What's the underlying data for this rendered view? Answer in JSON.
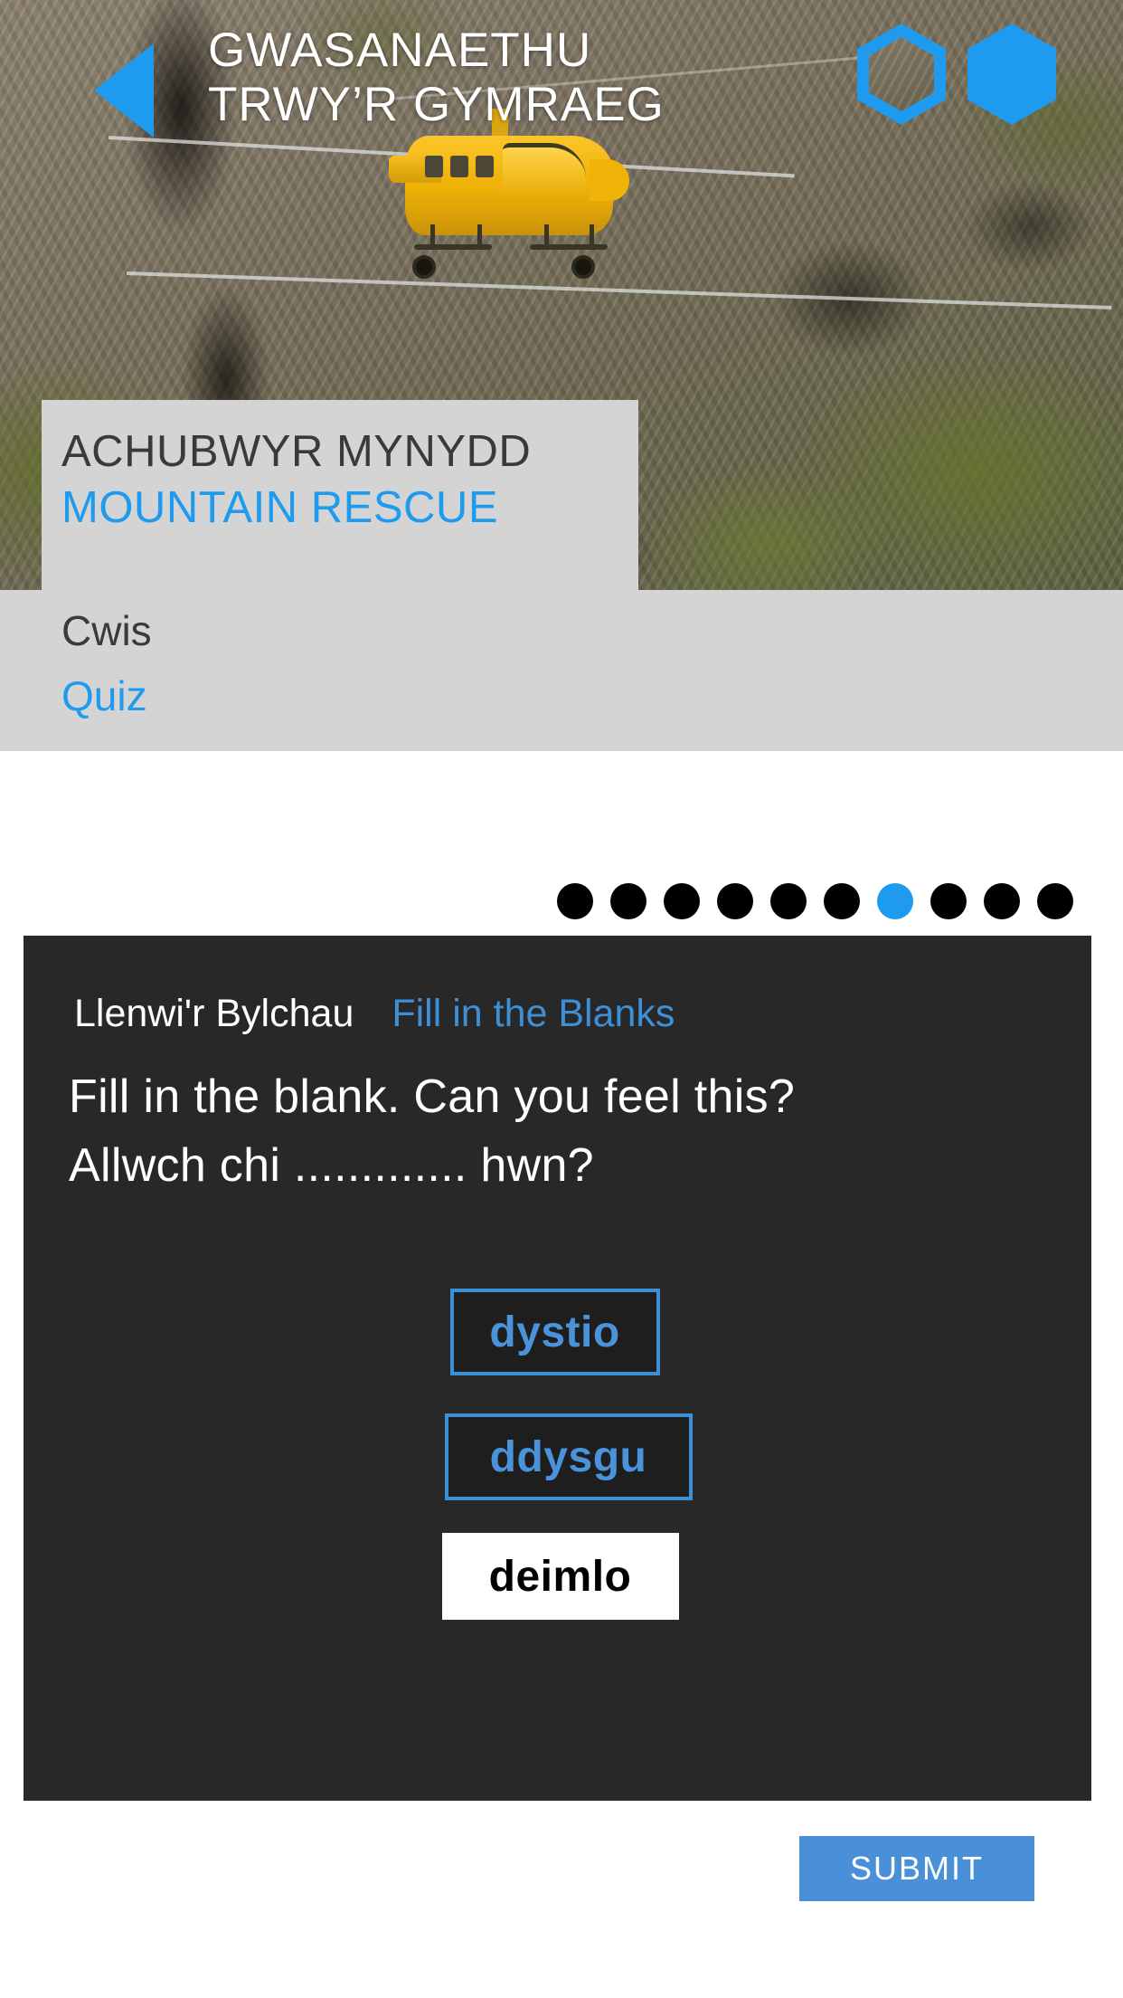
{
  "header": {
    "back_icon": "back-triangle-icon",
    "title_line1": "GWASANAETHU",
    "title_line2": "TRWY’R GYMRAEG",
    "logo_outline_icon": "hexagon-outline-icon",
    "logo_solid_icon": "hexagon-solid-icon"
  },
  "hero": {
    "photo_alt": "mountain-rescue-helicopter-photo",
    "helicopter_icon": "helicopter-icon"
  },
  "title_card": {
    "title_cy": "ACHUBWYR MYNYDD",
    "title_en": "MOUNTAIN RESCUE"
  },
  "subtitle": {
    "label_cy": "Cwis",
    "label_en": "Quiz"
  },
  "pagination": {
    "total": 10,
    "active_index": 6,
    "dots": [
      {
        "index": 0,
        "active": false
      },
      {
        "index": 1,
        "active": false
      },
      {
        "index": 2,
        "active": false
      },
      {
        "index": 3,
        "active": false
      },
      {
        "index": 4,
        "active": false
      },
      {
        "index": 5,
        "active": false
      },
      {
        "index": 6,
        "active": true
      },
      {
        "index": 7,
        "active": false
      },
      {
        "index": 8,
        "active": false
      },
      {
        "index": 9,
        "active": false
      }
    ]
  },
  "quiz": {
    "type_label_cy": "Llenwi'r Bylchau",
    "type_label_en": "Fill in the Blanks",
    "question_en": "Fill in the blank. Can you feel this?",
    "question_cy": "Allwch chi ............. hwn?",
    "options": [
      {
        "label": "dystio",
        "selected": false
      },
      {
        "label": "ddysgu",
        "selected": false
      },
      {
        "label": "deimlo",
        "selected": true
      }
    ]
  },
  "actions": {
    "submit_label": "SUBMIT"
  },
  "colors": {
    "accent_blue": "#1e9bee",
    "option_blue": "#3d8fd6",
    "submit_blue": "#4a90d9",
    "panel_dark": "#282828",
    "band_grey": "#d4d4d4"
  }
}
